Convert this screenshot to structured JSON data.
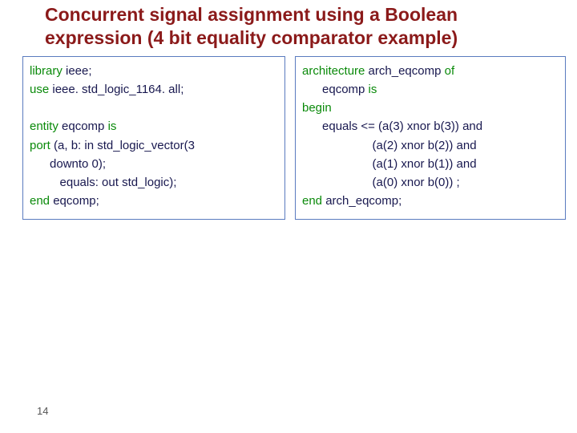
{
  "title_line1": "Concurrent signal assignment using a Boolean",
  "title_line2": "expression (4 bit equality comparator example)",
  "page_number": "14",
  "left": {
    "l1_kw": "library",
    "l1_tx": " ieee;",
    "l2_kw": "use",
    "l2_tx": " ieee. std_logic_1164. all;",
    "blank": " ",
    "l3_kw1": "entity",
    "l3_tx1": " eqcomp ",
    "l3_kw2": "is",
    "l4_kw": "port",
    "l4_tx": " (a, b: in std_logic_vector(3",
    "l5_tx": "      downto 0);",
    "l6_tx": "         equals: out std_logic);",
    "l7_kw": "end",
    "l7_tx": " eqcomp;"
  },
  "right": {
    "l1_kw1": "architecture",
    "l1_tx1": " arch_eqcomp ",
    "l1_kw2": "of",
    "l2_tx": "      eqcomp ",
    "l2_kw": "is",
    "l3_kw": "begin",
    "l4_tx": "      equals <= (a(3) xnor b(3)) and",
    "l5_tx": "                     (a(2) xnor b(2)) and",
    "l6_tx": "                     (a(1) xnor b(1)) and",
    "l7_tx": "                     (a(0) xnor b(0)) ;",
    "l8_kw": "end",
    "l8_tx": " arch_eqcomp;"
  }
}
